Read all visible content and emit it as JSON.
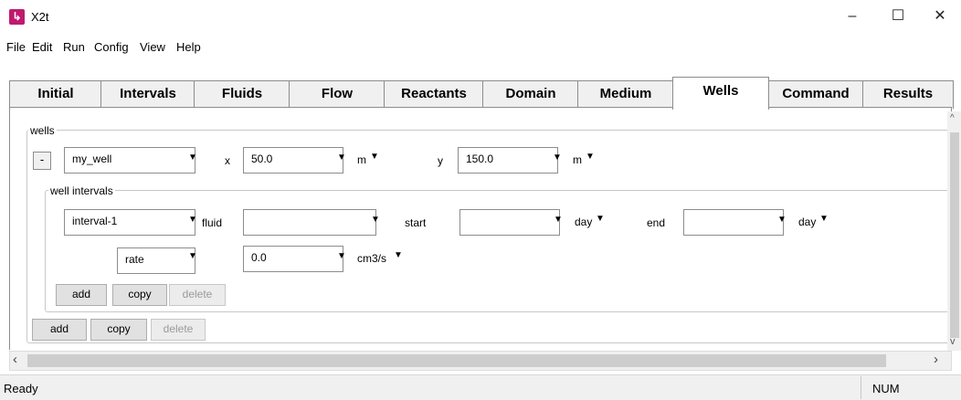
{
  "window": {
    "title": "X2t",
    "app_icon": "app-logo-icon",
    "minimize": "–",
    "maximize": "☐",
    "close": "✕"
  },
  "menu": [
    {
      "label": "File"
    },
    {
      "label": "Edit"
    },
    {
      "label": "Run"
    },
    {
      "label": "Config"
    },
    {
      "label": "View"
    },
    {
      "label": "Help"
    }
  ],
  "tabs": [
    {
      "label": "Initial"
    },
    {
      "label": "Intervals"
    },
    {
      "label": "Fluids"
    },
    {
      "label": "Flow"
    },
    {
      "label": "Reactants"
    },
    {
      "label": "Domain"
    },
    {
      "label": "Medium"
    },
    {
      "label": "Wells",
      "active": true
    },
    {
      "label": "Command"
    },
    {
      "label": "Results"
    }
  ],
  "wells": {
    "group_label": "wells",
    "remove_label": "-",
    "name": "my_well",
    "x_label": "x",
    "x_value": "50.0",
    "x_unit": "m",
    "y_label": "y",
    "y_value": "150.0",
    "y_unit": "m",
    "intervals": {
      "group_label": "well intervals",
      "name": "interval-1",
      "fluid_label": "fluid",
      "fluid_value": "",
      "start_label": "start",
      "start_value": "",
      "start_unit": "day",
      "end_label": "end",
      "end_value": "",
      "end_unit": "day",
      "rate_type": "rate",
      "rate_value": "0.0",
      "rate_unit": "cm3/s",
      "add_label": "add",
      "copy_label": "copy",
      "delete_label": "delete"
    },
    "add_label": "add",
    "copy_label": "copy",
    "delete_label": "delete"
  },
  "status": {
    "text": "Ready",
    "num": "NUM"
  },
  "colors": {
    "accent": "#c0196e"
  }
}
